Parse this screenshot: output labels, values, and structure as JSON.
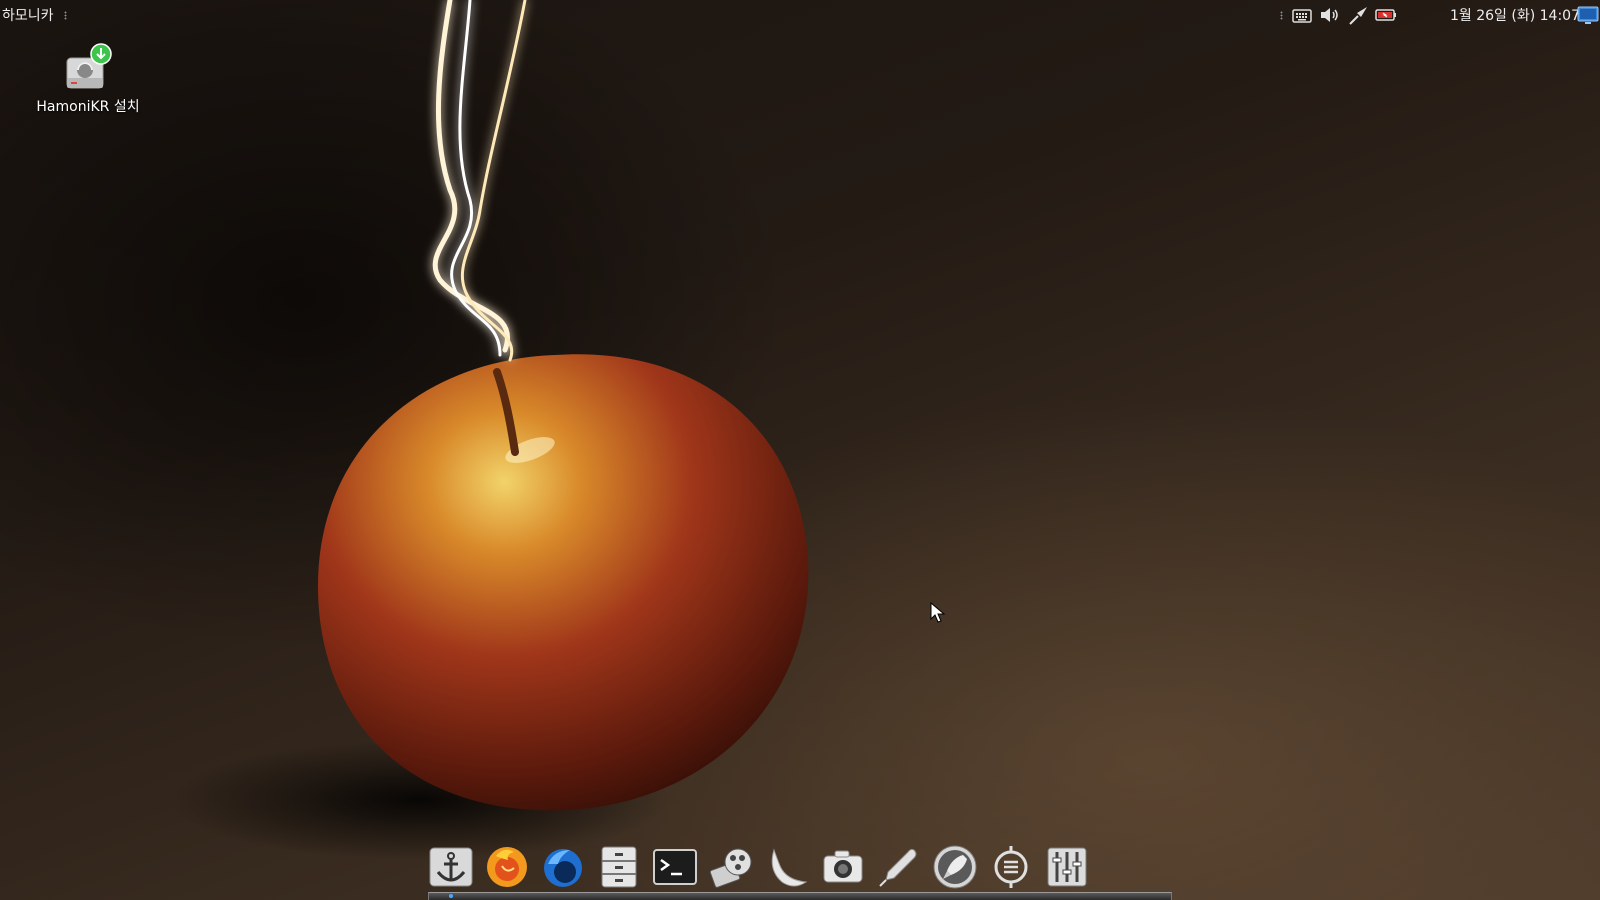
{
  "top_panel": {
    "menu_label": "하모니카",
    "clock": "1월 26일 (화) 14:07",
    "tray_icons": [
      "keyboard-icon",
      "volume-icon",
      "network-cable-icon",
      "battery-icon"
    ],
    "show_desktop_icon": "show-desktop-icon"
  },
  "desktop": {
    "icons": [
      {
        "label": "HamoniKR 설치",
        "icon": "installer-icon"
      }
    ]
  },
  "dock": {
    "items": [
      "anchor-icon",
      "firefox-icon",
      "thunderbird-icon",
      "file-manager-icon",
      "terminal-icon",
      "media-icon",
      "moon-icon",
      "camera-icon",
      "pen-icon",
      "rocket-icon",
      "synaptic-icon",
      "settings-icon"
    ],
    "active_indicator_color": "#4aa8ff"
  },
  "colors": {
    "firefox_orange": "#f39a1e",
    "thunderbird_blue": "#1e6fd0",
    "installer_green": "#3cc54a"
  }
}
